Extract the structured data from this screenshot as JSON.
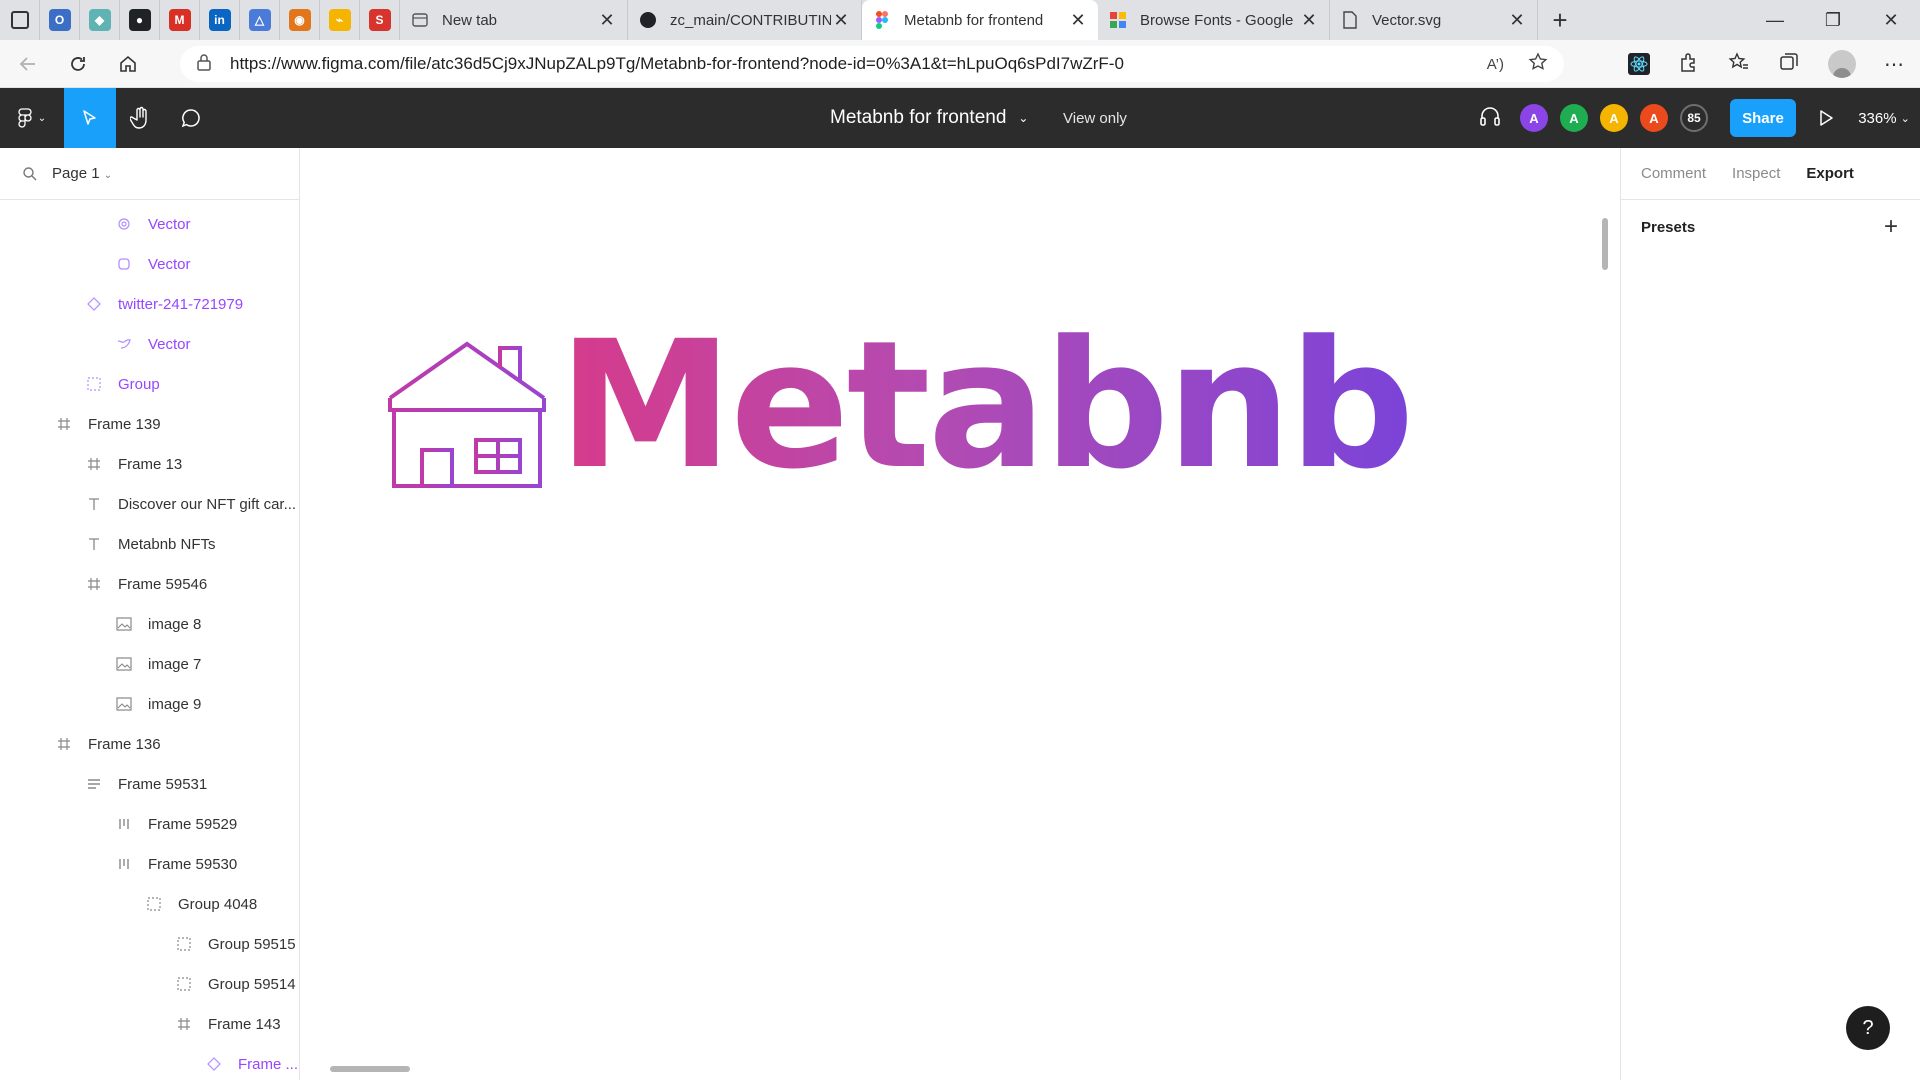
{
  "browser": {
    "pinned": [
      {
        "icon": "tab-actions-icon"
      },
      {
        "icon": "outlook-icon",
        "color": "#3b6fc5"
      },
      {
        "icon": "diamond-app-icon",
        "color": "#5fb3b3"
      },
      {
        "icon": "github-icon",
        "color": "#1f2328"
      },
      {
        "icon": "gmail-icon",
        "color": "#d93025"
      },
      {
        "icon": "linkedin-icon",
        "color": "#0a66c2"
      },
      {
        "icon": "azure-icon",
        "color": "#4a7bd8"
      },
      {
        "icon": "metamask-icon",
        "color": "#e2761b"
      },
      {
        "icon": "bolt-icon",
        "color": "#f5b400"
      },
      {
        "icon": "s-app-icon",
        "color": "#d6342c"
      }
    ],
    "tabs": [
      {
        "title": "New tab",
        "icon": "newtab-icon",
        "active": false
      },
      {
        "title": "zc_main/CONTRIBUTIN",
        "icon": "github-icon",
        "active": false
      },
      {
        "title": "Metabnb for frontend",
        "icon": "figma-icon",
        "active": true
      },
      {
        "title": "Browse Fonts - Google",
        "icon": "google-fonts-icon",
        "active": false
      },
      {
        "title": "Vector.svg",
        "icon": "file-icon",
        "active": false
      }
    ],
    "url": "https://www.figma.com/file/atc36d5Cj9xJNupZALp9Tg/Metabnb-for-frontend?node-id=0%3A1&t=hLpuOq6sPdI7wZrF-0"
  },
  "figma": {
    "file_title": "Metabnb for frontend",
    "view_mode": "View only",
    "avatars": [
      {
        "letter": "A",
        "color": "#8b44e6"
      },
      {
        "letter": "A",
        "color": "#1fad52"
      },
      {
        "letter": "A",
        "color": "#f4b400"
      },
      {
        "letter": "A",
        "color": "#ea4a1c"
      }
    ],
    "viewer_count": "85",
    "share_label": "Share",
    "zoom": "336%",
    "page_name": "Page 1",
    "layers": [
      {
        "name": "Vector",
        "icon": "component-instance-icon",
        "indent": 3,
        "comp": true
      },
      {
        "name": "Vector",
        "icon": "vector-icon",
        "indent": 3,
        "comp": true
      },
      {
        "name": "twitter-241-721979",
        "icon": "diamond-instance-icon",
        "indent": 2,
        "comp": true
      },
      {
        "name": "Vector",
        "icon": "vector-path-icon",
        "indent": 3,
        "comp": true
      },
      {
        "name": "Group",
        "icon": "group-icon",
        "indent": 2,
        "comp": true
      },
      {
        "name": "Frame 139",
        "icon": "frame-icon",
        "indent": 1,
        "comp": false
      },
      {
        "name": "Frame 13",
        "icon": "frame-icon",
        "indent": 2,
        "comp": false
      },
      {
        "name": "Discover our NFT gift car...",
        "icon": "text-icon",
        "indent": 2,
        "comp": false
      },
      {
        "name": "Metabnb NFTs",
        "icon": "text-icon",
        "indent": 2,
        "comp": false
      },
      {
        "name": "Frame 59546",
        "icon": "frame-icon",
        "indent": 2,
        "comp": false
      },
      {
        "name": "image 8",
        "icon": "image-icon",
        "indent": 3,
        "comp": false
      },
      {
        "name": "image 7",
        "icon": "image-icon",
        "indent": 3,
        "comp": false
      },
      {
        "name": "image 9",
        "icon": "image-icon",
        "indent": 3,
        "comp": false
      },
      {
        "name": "Frame 136",
        "icon": "frame-icon",
        "indent": 1,
        "comp": false
      },
      {
        "name": "Frame 59531",
        "icon": "autolayout-rows-icon",
        "indent": 2,
        "comp": false
      },
      {
        "name": "Frame 59529",
        "icon": "autolayout-cols-icon",
        "indent": 3,
        "comp": false
      },
      {
        "name": "Frame 59530",
        "icon": "autolayout-cols-icon",
        "indent": 3,
        "comp": false
      },
      {
        "name": "Group 4048",
        "icon": "group-icon",
        "indent": 4,
        "comp": false
      },
      {
        "name": "Group 59515",
        "icon": "group-icon",
        "indent": 5,
        "comp": false
      },
      {
        "name": "Group 59514",
        "icon": "group-icon",
        "indent": 5,
        "comp": false
      },
      {
        "name": "Frame 143",
        "icon": "frame-icon",
        "indent": 5,
        "comp": false
      },
      {
        "name": "Frame ...",
        "icon": "diamond-instance-icon",
        "indent": 6,
        "comp": true
      }
    ],
    "canvas": {
      "wordmark": "Metabnb",
      "gradient_start": "#d63b8a",
      "gradient_end": "#7b43d8"
    },
    "right_panel": {
      "tabs": [
        {
          "label": "Comment",
          "active": false
        },
        {
          "label": "Inspect",
          "active": false
        },
        {
          "label": "Export",
          "active": true
        }
      ],
      "presets_label": "Presets"
    },
    "help_label": "?"
  }
}
